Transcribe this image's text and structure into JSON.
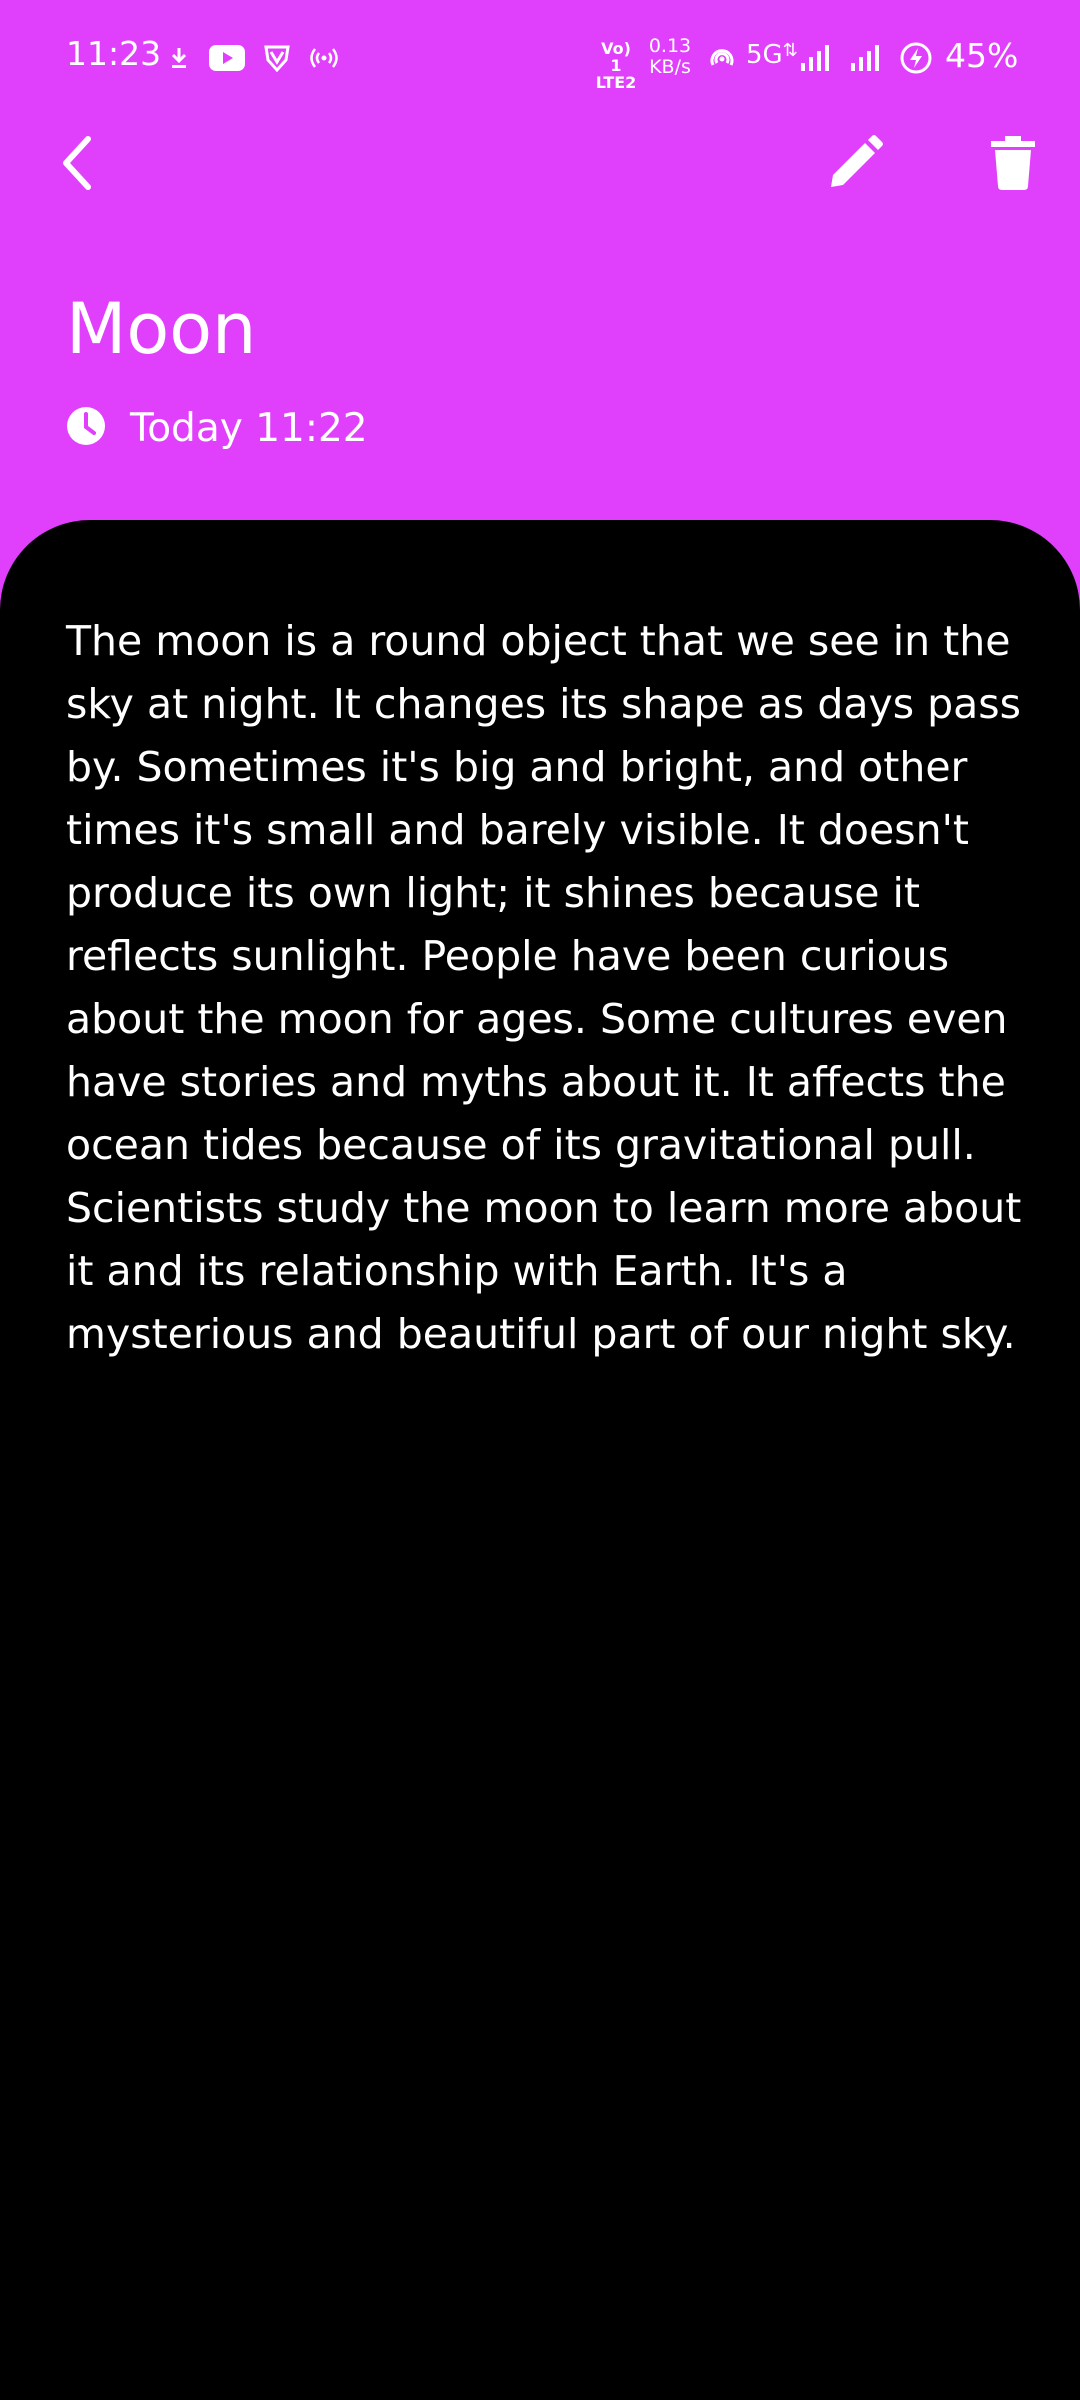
{
  "colors": {
    "header_bg": "#E040FB",
    "content_bg": "#000000",
    "text": "#FFFFFF"
  },
  "status_bar": {
    "time": "11:23",
    "volte_top": "Vo) 1",
    "volte_bottom": "LTE2",
    "net_speed_value": "0.13",
    "net_speed_unit": "KB/s",
    "network_type": "5G",
    "battery": "45%",
    "icons": [
      "download-icon",
      "youtube-icon",
      "vpn-shield-icon",
      "hotspot-icon",
      "volte-icon",
      "wifi-hotspot-icon",
      "signal-bars-icon",
      "signal-bars-icon",
      "battery-charging-icon"
    ]
  },
  "toolbar": {
    "back_icon": "chevron-left-icon",
    "edit_icon": "pencil-icon",
    "delete_icon": "trash-icon"
  },
  "note": {
    "title": "Moon",
    "date": "Today 11:22",
    "body": "The moon is a round object that we see in the sky at night. It changes its shape as days pass by. Sometimes it's big and bright, and other times it's small and barely visible. It doesn't produce its own light; it shines because it reflects sunlight. People have been curious about the moon for ages. Some cultures even have stories and myths about it. It affects the ocean tides because of its gravitational pull. Scientists study the moon to learn more about it and its relationship with Earth. It's a mysterious and beautiful part of our night sky."
  }
}
